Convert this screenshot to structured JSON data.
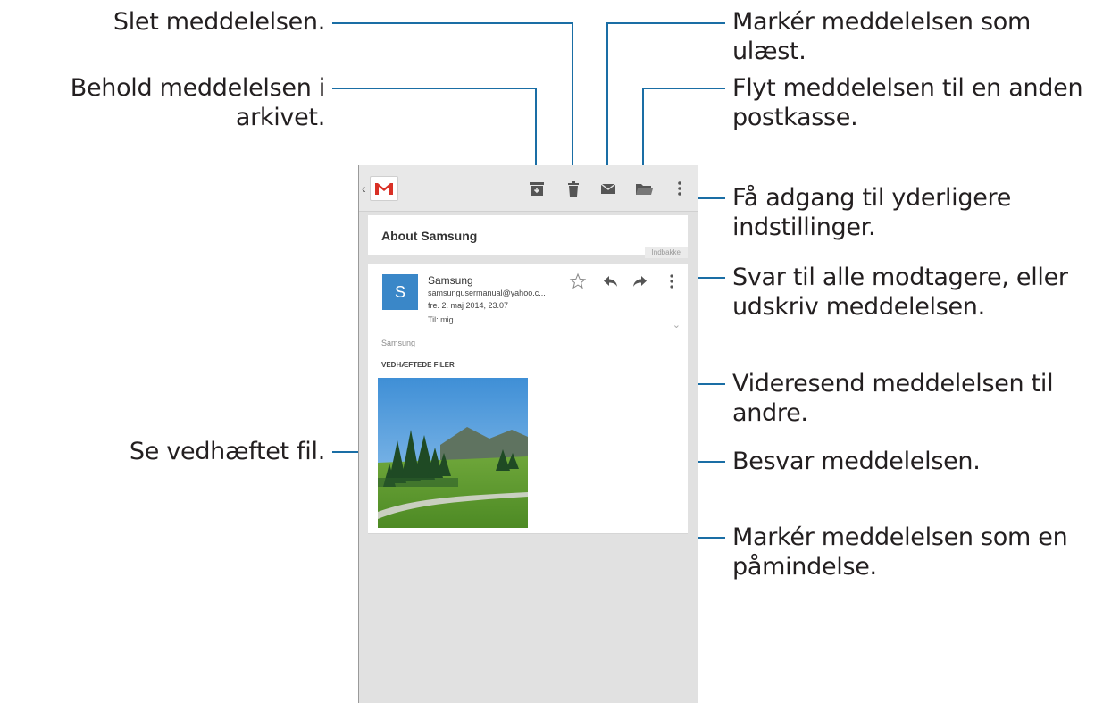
{
  "callouts": {
    "delete": "Slet meddelelsen.",
    "archive": "Behold meddelelsen i arkivet.",
    "view_attachment": "Se vedhæftet fil.",
    "mark_unread": "Markér meddelelsen som ulæst.",
    "move_line1": "Flyt meddelelsen til en anden",
    "move_line2": "postkasse.",
    "more_line1": "Få adgang til yderligere",
    "more_line2": "indstillinger.",
    "reply_all_line1": "Svar til alle modtagere, eller",
    "reply_all_line2": "udskriv meddelelsen.",
    "forward": "Videresend meddelelsen til andre.",
    "reply": "Besvar meddelelsen.",
    "star_line1": "Markér meddelelsen som en",
    "star_line2": "påmindelse."
  },
  "actionbar": {
    "icons": [
      "back-chevron-icon",
      "gmail-logo",
      "archive-icon",
      "trash-icon",
      "mail-icon",
      "folder-icon",
      "overflow-menu-icon"
    ]
  },
  "email": {
    "subject": "About Samsung",
    "label": "Indbakke",
    "avatar_letter": "S",
    "sender": "Samsung",
    "address": "samsungusermanual@yahoo.c...",
    "date": "fre. 2. maj 2014, 23.07",
    "to": "Til: mig",
    "body": "Samsung",
    "attachments_heading": "VEDHÆFTEDE FILER"
  },
  "colors": {
    "leader_line": "#1a6ea5",
    "avatar": "#3a87c8",
    "gmail_red": "#d93025"
  }
}
